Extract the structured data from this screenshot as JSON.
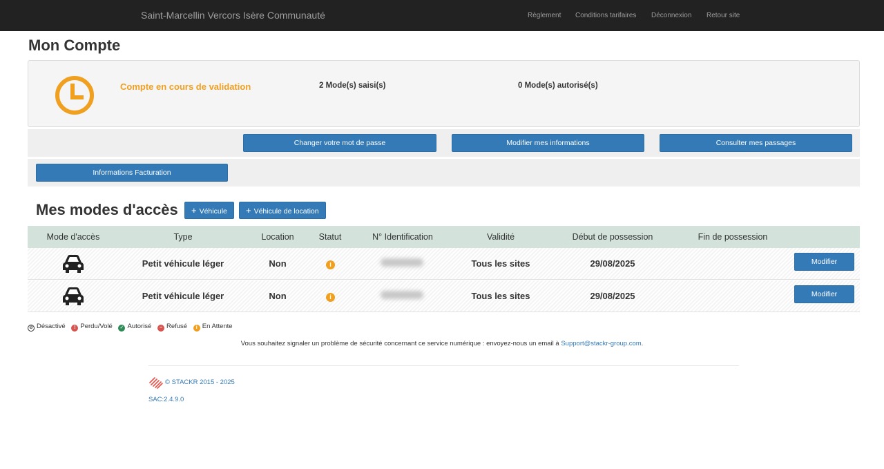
{
  "header": {
    "brand": "Saint-Marcellin Vercors Isère Communauté",
    "nav": [
      "Règlement",
      "Conditions tarifaires",
      "Déconnexion",
      "Retour site"
    ]
  },
  "page_title": "Mon Compte",
  "account_status": {
    "status_label": "Compte en cours de validation",
    "modes_saisis": "2 Mode(s) saisi(s)",
    "modes_autorises": "0 Mode(s) autorisé(s)",
    "status_color": "#f0a020",
    "icon": "clock-icon"
  },
  "actions": {
    "change_password": "Changer votre mot de passe",
    "edit_info": "Modifier mes informations",
    "view_passages": "Consulter mes passages",
    "billing_info": "Informations Facturation"
  },
  "access_modes": {
    "title": "Mes modes d'accès",
    "add_vehicle": "Véhicule",
    "add_rental": "Véhicule de location",
    "columns": [
      "Mode d'accès",
      "Type",
      "Location",
      "Statut",
      "N° Identification",
      "Validité",
      "Début de possession",
      "Fin de possession"
    ],
    "rows": [
      {
        "icon": "car-icon",
        "type": "Petit véhicule léger",
        "location": "Non",
        "status_icon": "info-icon",
        "validity": "Tous les sites",
        "start": "29/08/2025",
        "end": "",
        "action": "Modifier"
      },
      {
        "icon": "car-icon",
        "type": "Petit véhicule léger",
        "location": "Non",
        "status_icon": "info-icon",
        "validity": "Tous les sites",
        "start": "29/08/2025",
        "end": "",
        "action": "Modifier"
      }
    ]
  },
  "legend": [
    {
      "label": "Désactivé",
      "color": "#333333",
      "icon": "ban-icon"
    },
    {
      "label": "Perdu/Volé",
      "color": "#d9534f",
      "icon": "exclamation-icon"
    },
    {
      "label": "Autorisé",
      "color": "#2e8b57",
      "icon": "check-icon"
    },
    {
      "label": "Refusé",
      "color": "#d9534f",
      "icon": "minus-icon"
    },
    {
      "label": "En Attente",
      "color": "#f0a020",
      "icon": "info-icon"
    }
  ],
  "security": {
    "text": "Vous souhaitez signaler un problème de sécurité concernant ce service numérique : envoyez-nous un email à ",
    "email": "Support@stackr-group.com",
    "suffix": "."
  },
  "footer": {
    "copyright": "© STACKR 2015 - 2025",
    "version": "SAC:2.4.9.0"
  },
  "colors": {
    "primary": "#337ab7",
    "navbar": "#222222",
    "table_header": "#d3e3dc"
  }
}
